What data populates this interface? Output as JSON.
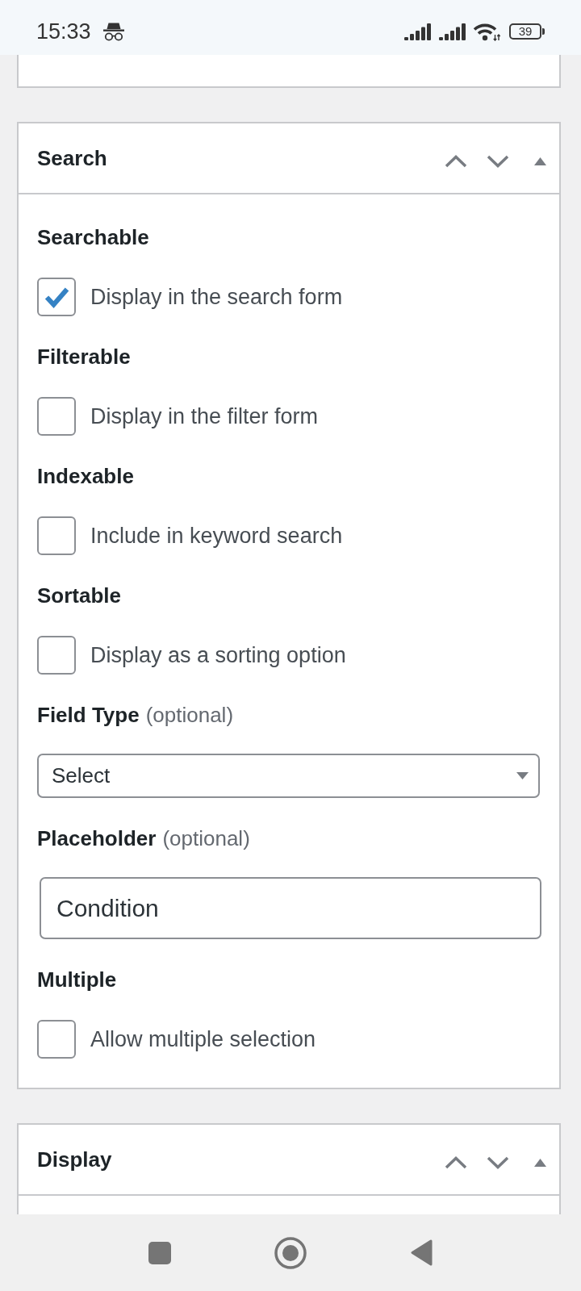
{
  "status_bar": {
    "time": "15:33",
    "battery": "39"
  },
  "panels": [
    {
      "kind": "clipped"
    },
    {
      "kind": "section",
      "title": "Search",
      "expanded": true,
      "fields": [
        {
          "kind": "checkbox",
          "label": "Searchable",
          "option": "Display in the search form",
          "checked": true
        },
        {
          "kind": "checkbox",
          "label": "Filterable",
          "option": "Display in the filter form",
          "checked": false
        },
        {
          "kind": "checkbox",
          "label": "Indexable",
          "option": "Include in keyword search",
          "checked": false
        },
        {
          "kind": "checkbox",
          "label": "Sortable",
          "option": "Display as a sorting option",
          "checked": false
        },
        {
          "kind": "select",
          "label": "Field Type",
          "note": "(optional)",
          "value": "Select"
        },
        {
          "kind": "text",
          "label": "Placeholder",
          "note": "(optional)",
          "value": "Condition"
        },
        {
          "kind": "checkbox",
          "label": "Multiple",
          "option": "Allow multiple selection",
          "checked": false
        }
      ]
    },
    {
      "kind": "section",
      "title": "Display",
      "expanded": true
    }
  ]
}
